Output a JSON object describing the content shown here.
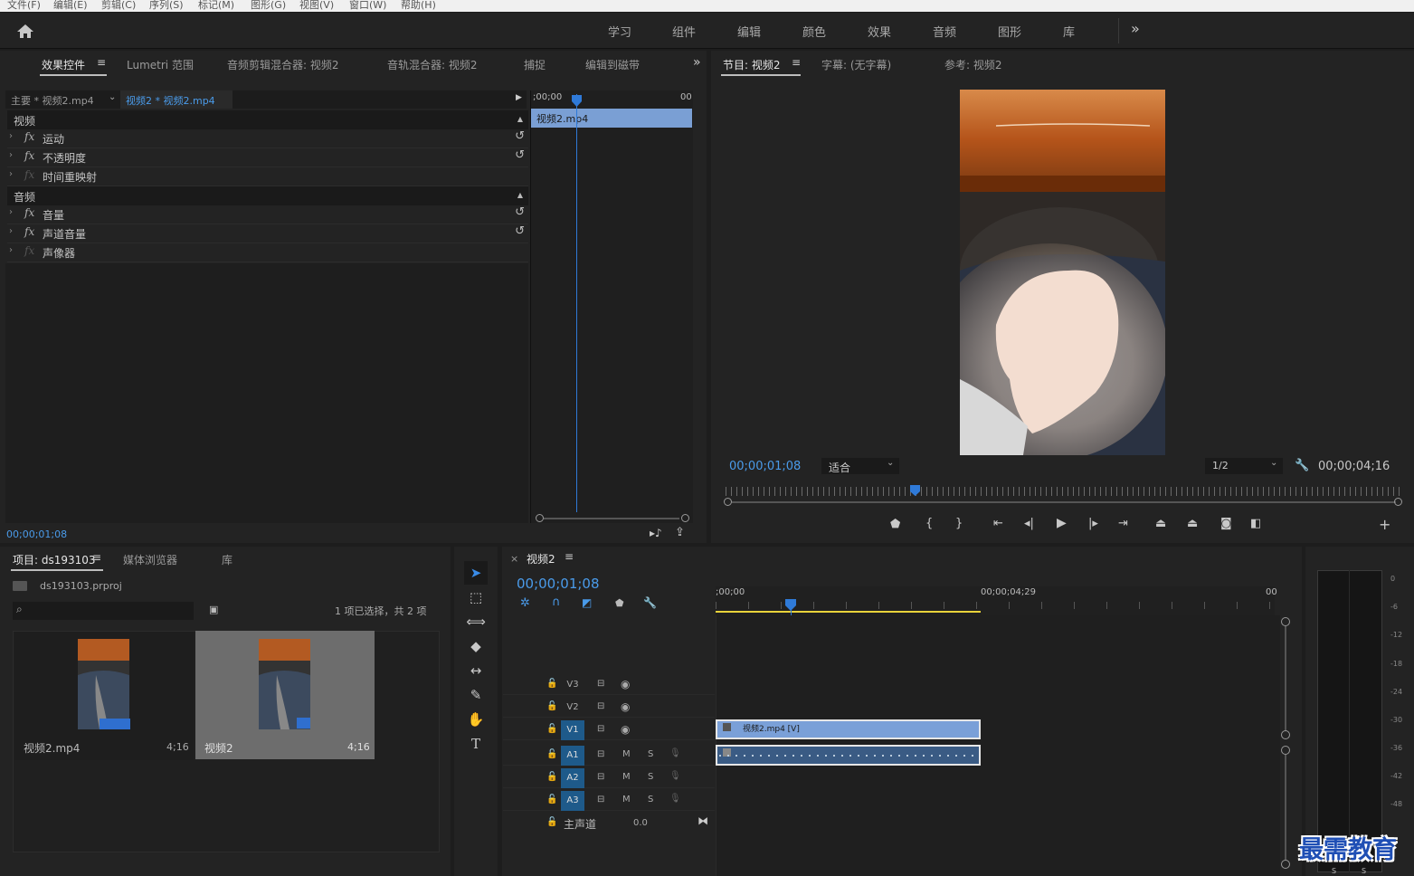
{
  "menu": [
    "文件(F)",
    "编辑(E)",
    "剪辑(C)",
    "序列(S)",
    "标记(M)",
    "图形(G)",
    "视图(V)",
    "窗口(W)",
    "帮助(H)"
  ],
  "workspaces": [
    "学习",
    "组件",
    "编辑",
    "颜色",
    "效果",
    "音频",
    "图形",
    "库"
  ],
  "effect_panel": {
    "tabs": [
      "效果控件",
      "Lumetri 范围",
      "音频剪辑混合器: 视频2",
      "音轨混合器: 视频2",
      "捕捉",
      "编辑到磁带"
    ],
    "master_label": "主要 * 视频2.mp4",
    "clip_label": "视频2 * 视频2.mp4",
    "mini_tl_start": ";00;00",
    "mini_tl_end": "00",
    "mini_clip_name": "视频2.mp4",
    "video_section": "视频",
    "audio_section": "音频",
    "video_effects": [
      "运动",
      "不透明度",
      "时间重映射"
    ],
    "audio_effects": [
      "音量",
      "声道音量",
      "声像器"
    ],
    "timecode": "00;00;01;08"
  },
  "program_panel": {
    "tabs": [
      "节目: 视频2",
      "字幕: (无字幕)",
      "参考: 视频2"
    ],
    "timecode": "00;00;01;08",
    "fit_label": "适合",
    "resolution": "1/2",
    "duration": "00;00;04;16"
  },
  "project_panel": {
    "tabs": [
      "项目: ds193103",
      "媒体浏览器",
      "库"
    ],
    "project_file": "ds193103.prproj",
    "search_placeholder": "",
    "selection_status": "1 项已选择，共 2 项",
    "items": [
      {
        "name": "视频2.mp4",
        "duration": "4;16"
      },
      {
        "name": "视频2",
        "duration": "4;16"
      }
    ]
  },
  "timeline_panel": {
    "sequence_name": "视频2",
    "timecode": "00;00;01;08",
    "ruler_start": ";00;00",
    "ruler_mid": "00;00;04;29",
    "ruler_end": "00",
    "video_tracks": [
      "V3",
      "V2",
      "V1"
    ],
    "audio_tracks": [
      "A1",
      "A2",
      "A3"
    ],
    "mute_label": "M",
    "solo_label": "S",
    "master_label": "主声道",
    "master_value": "0.0",
    "video_clip": "视频2.mp4 [V]"
  },
  "audio_meter": {
    "ticks": [
      "0",
      "-6",
      "-12",
      "-18",
      "-24",
      "-30",
      "-36",
      "-42",
      "-48"
    ],
    "solo_labels": [
      "S",
      "S"
    ]
  },
  "watermark": "最需教育",
  "colors": {
    "accent": "#4a9bea",
    "clip_video": "#6f93c9",
    "clip_audio": "#3a5b84",
    "work_area": "#e9d33a",
    "watermark": "#1f4fb5"
  }
}
